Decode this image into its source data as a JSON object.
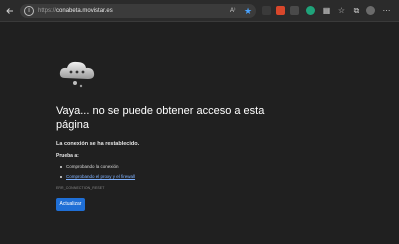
{
  "address_bar": {
    "protocol": "https://",
    "host": "conabeta.movistar.es",
    "read_aloud": "A⁾"
  },
  "error_page": {
    "title": "Vaya... no se puede obtener acceso a esta página",
    "subtitle": "La conexión se ha restablecido.",
    "try_label": "Prueba a:",
    "suggestions": [
      {
        "text": "Comprobando la conexión",
        "is_link": false
      },
      {
        "text": "Comprobando el proxy y el firewall",
        "is_link": true
      }
    ],
    "error_code": "ERR_CONNECTION_RESET",
    "refresh_label": "Actualizar"
  },
  "colors": {
    "background": "#202020",
    "accent": "#1f6fd6",
    "link": "#7fb2ff"
  },
  "icons": {
    "back": "back-arrow-icon",
    "info": "info-icon",
    "star": "favorite-star-icon",
    "error": "sad-cloud-icon"
  }
}
